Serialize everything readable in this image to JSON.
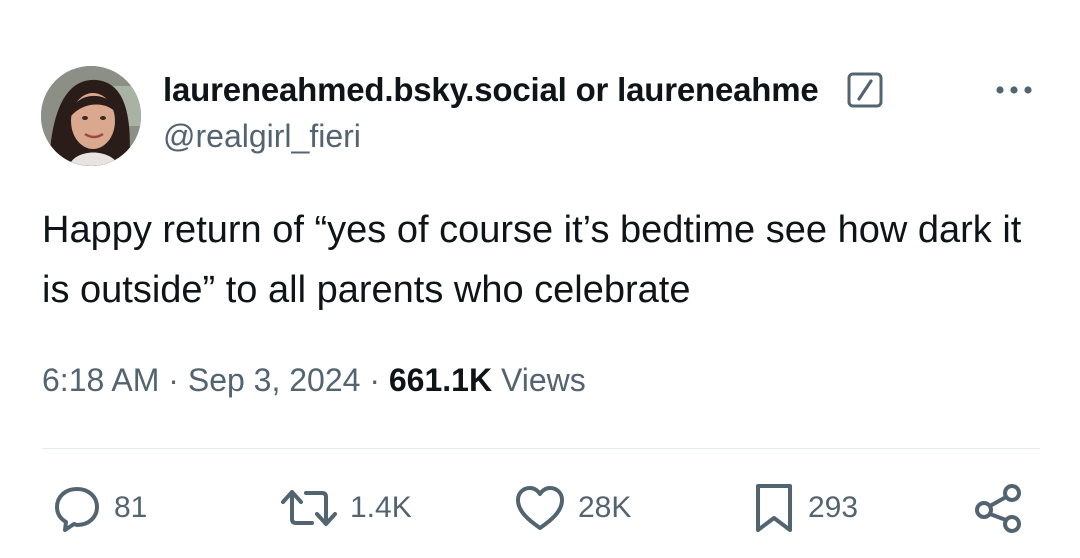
{
  "colors": {
    "text_primary": "#0f1419",
    "text_secondary": "#536471",
    "divider": "#e6ecf0"
  },
  "author": {
    "display_name": "laureneahmed.bsky.social or laureneahme",
    "handle": "@realgirl_fieri",
    "badge_icon": "slash-square-icon",
    "avatar_icon": "user-avatar"
  },
  "more_icon": "more-options-icon",
  "tweet": {
    "text": "Happy return of “yes of course it’s bedtime see how dark it is outside” to all parents who celebrate"
  },
  "meta": {
    "time": "6:18 AM",
    "separator": " · ",
    "date": "Sep 3, 2024",
    "views_count": "661.1K",
    "views_label": " Views"
  },
  "actions": {
    "replies": {
      "icon": "reply-icon",
      "count": "81"
    },
    "reposts": {
      "icon": "repost-icon",
      "count": "1.4K"
    },
    "likes": {
      "icon": "heart-icon",
      "count": "28K"
    },
    "bookmarks": {
      "icon": "bookmark-icon",
      "count": "293"
    },
    "share": {
      "icon": "share-icon"
    }
  }
}
